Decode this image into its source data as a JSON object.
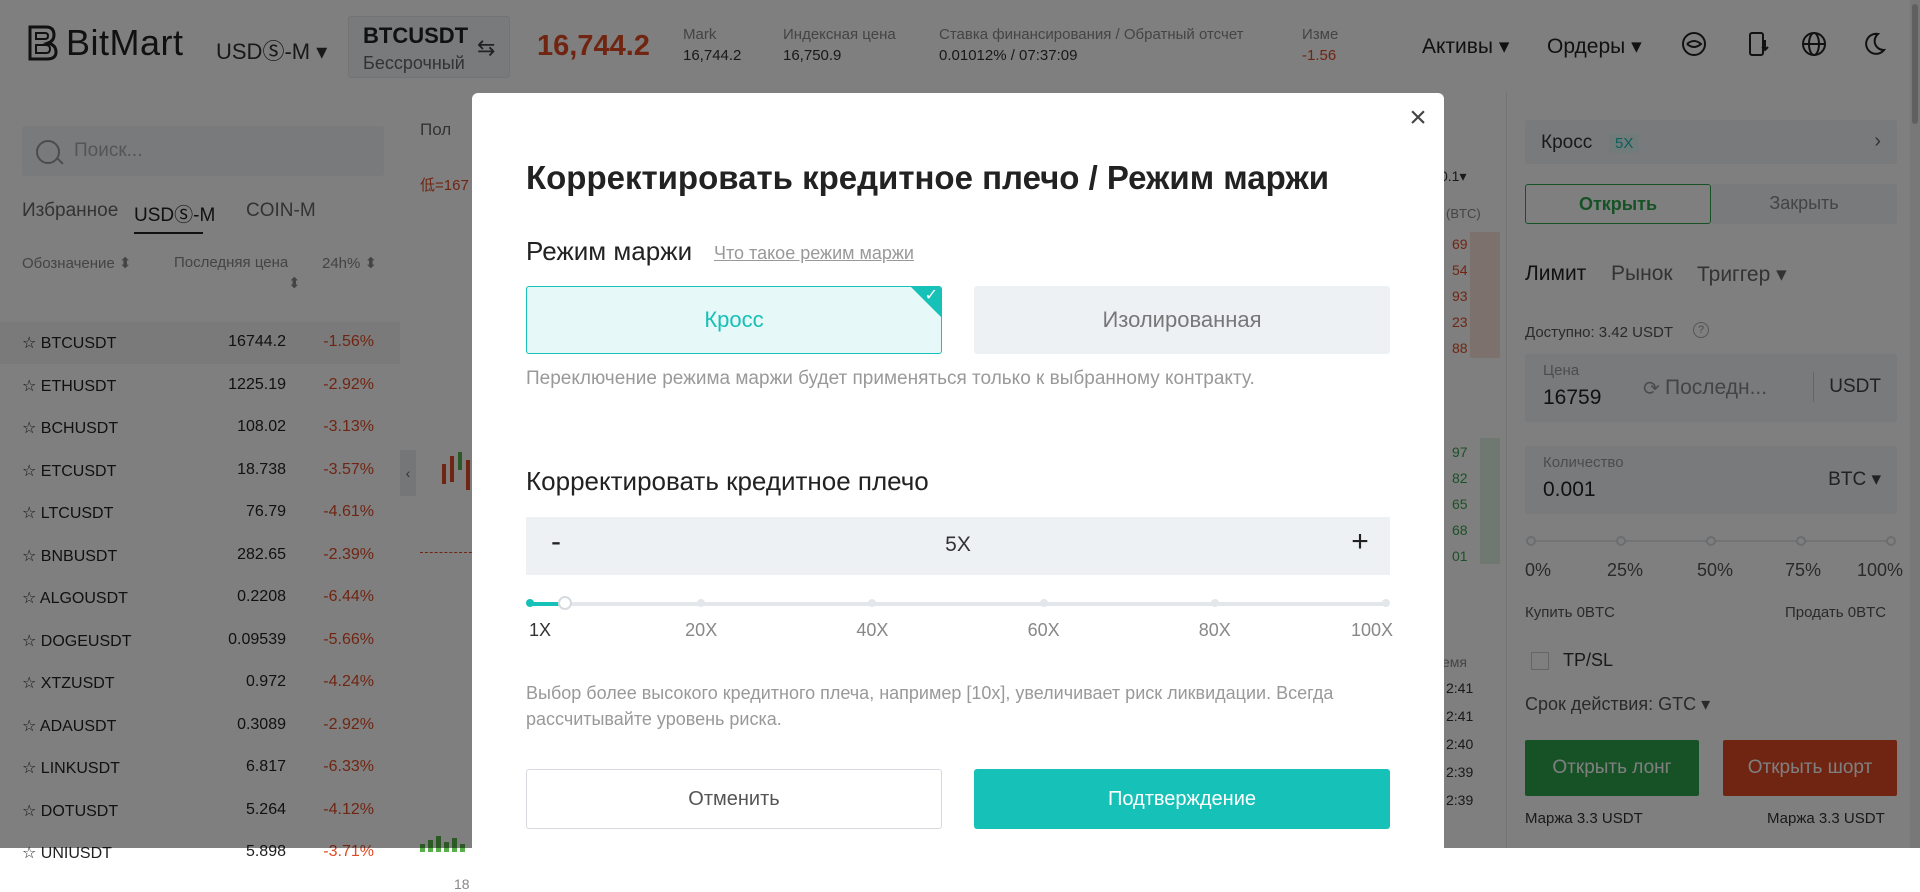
{
  "header": {
    "brand": "BitMart",
    "market": "USDⓈ-M ▾",
    "symbol": "BTCUSDT",
    "symbol_type": "Бессрочный",
    "last_price": "16,744.2",
    "stats": [
      {
        "label": "Mark",
        "value": "16,744.2"
      },
      {
        "label": "Индексная цена",
        "value": "16,750.9"
      },
      {
        "label": "Ставка финансирования / Обратный отсчет",
        "value": "0.01012% / 07:37:09"
      },
      {
        "label": "Изме",
        "value": "-1.56"
      }
    ],
    "menu": {
      "assets": "Активы ▾",
      "orders": "Ордеры ▾"
    },
    "icons": [
      "support-icon",
      "download-icon",
      "globe-icon",
      "moon-icon"
    ]
  },
  "left": {
    "search_placeholder": "Поиск...",
    "tabs": [
      "Избранное",
      "USDⓈ-M",
      "COIN-M"
    ],
    "columns": [
      "Обозначение ⬍",
      "Последняя цена",
      "24h% ⬍"
    ],
    "rows": [
      {
        "sym": "☆ BTCUSDT",
        "price": "16744.2",
        "chg": "-1.56%"
      },
      {
        "sym": "☆ ETHUSDT",
        "price": "1225.19",
        "chg": "-2.92%"
      },
      {
        "sym": "☆ BCHUSDT",
        "price": "108.02",
        "chg": "-3.13%"
      },
      {
        "sym": "☆ ETCUSDT",
        "price": "18.738",
        "chg": "-3.57%"
      },
      {
        "sym": "☆ LTCUSDT",
        "price": "76.79",
        "chg": "-4.61%"
      },
      {
        "sym": "☆ BNBUSDT",
        "price": "282.65",
        "chg": "-2.39%"
      },
      {
        "sym": "☆ ALGOUSDT",
        "price": "0.2208",
        "chg": "-6.44%"
      },
      {
        "sym": "☆ DOGEUSDT",
        "price": "0.09539",
        "chg": "-5.66%"
      },
      {
        "sym": "☆ XTZUSDT",
        "price": "0.972",
        "chg": "-4.24%"
      },
      {
        "sym": "☆ ADAUSDT",
        "price": "0.3089",
        "chg": "-2.92%"
      },
      {
        "sym": "☆ LINKUSDT",
        "price": "6.817",
        "chg": "-6.33%"
      },
      {
        "sym": "☆ DOTUSDT",
        "price": "5.264",
        "chg": "-4.12%"
      },
      {
        "sym": "☆ UNIUSDT",
        "price": "5.898",
        "chg": "-3.71%"
      }
    ]
  },
  "mid": {
    "chart_tab": "Пол",
    "low_label": "低=167",
    "x_tick": "18",
    "lot_select": "0.1▾",
    "ob_unit": "(BTC)",
    "ob_asks": [
      "69",
      "54",
      "93",
      "23",
      "88"
    ],
    "ob_bids": [
      "97",
      "82",
      "65",
      "68",
      "01"
    ],
    "time_header": "емя",
    "times": [
      "2:41",
      "2:41",
      "2:40",
      "2:39",
      "2:39"
    ]
  },
  "right": {
    "margin_mode": "Кросс",
    "leverage_badge": "5X",
    "open": "Открыть",
    "close": "Закрыть",
    "order_tabs": [
      "Лимит",
      "Рынок",
      "Триггер ▾"
    ],
    "available": "Доступно: 3.42 USDT",
    "price_label": "Цена",
    "price_value": "16759",
    "price_mode": "Последн...",
    "price_unit": "USDT",
    "qty_label": "Количество",
    "qty_value": "0.001",
    "qty_unit": "BTC ▾",
    "percents": [
      "0%",
      "25%",
      "50%",
      "75%",
      "100%"
    ],
    "buy": "Купить 0BTC",
    "sell": "Продать 0BTC",
    "tpsl": "TP/SL",
    "validity": "Срок действия: GTC ▾",
    "long": "Открыть лонг",
    "short": "Открыть шорт",
    "margin_long": "Маржа 3.3 USDT",
    "margin_short": "Маржа 3.3 USDT"
  },
  "modal": {
    "title": "Корректировать кредитное плечо / Режим маржи",
    "margin_mode_label": "Режим маржи",
    "margin_mode_link": "Что такое режим маржи",
    "cross": "Кросс",
    "isolated": "Изолированная",
    "mode_note": "Переключение режима маржи будет применяться только к выбранному контракту.",
    "leverage_label": "Корректировать кредитное плечо",
    "minus": "-",
    "plus": "+",
    "leverage_value": "5X",
    "leverage_numeric": 5,
    "leverage_max": 100,
    "ticks": [
      "1X",
      "20X",
      "40X",
      "60X",
      "80X",
      "100X"
    ],
    "warning": "Выбор более высокого кредитного плеча, например [10x], увеличивает риск ликвидации. Всегда рассчитывайте уровень риска.",
    "cancel": "Отменить",
    "confirm": "Подтверждение",
    "close_icon": "×"
  },
  "colors": {
    "accent": "#16c1b8",
    "down": "#e04a25",
    "up": "#2ea44f"
  }
}
